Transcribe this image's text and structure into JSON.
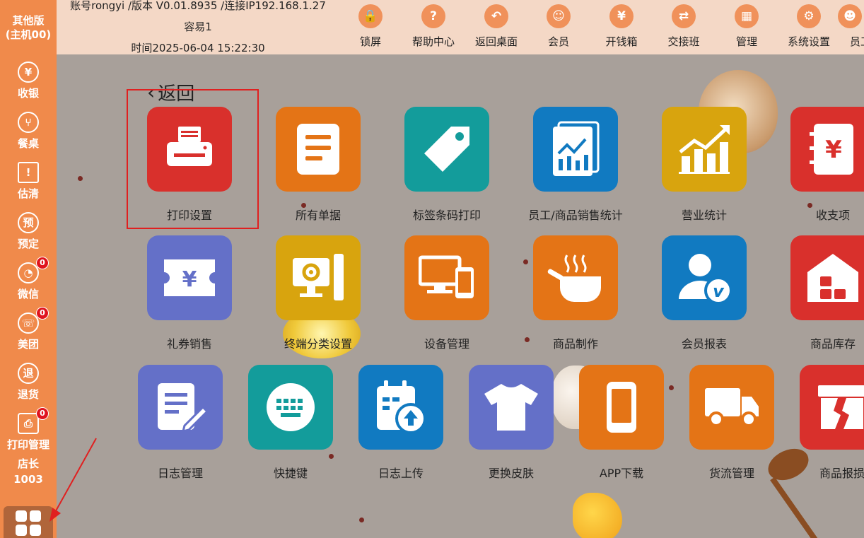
{
  "sidebar": {
    "brand_line1": "其他版",
    "brand_line2": "(主机00)",
    "items": [
      {
        "label": "收银",
        "glyph": "¥",
        "icon": "yen-icon",
        "badge": null
      },
      {
        "label": "餐桌",
        "glyph": "⑂",
        "icon": "fork-knife-icon",
        "badge": null
      },
      {
        "label": "估清",
        "glyph": "!",
        "icon": "warning-icon",
        "badge": null
      },
      {
        "label": "预定",
        "glyph": "预",
        "icon": "reserve-icon",
        "badge": null
      },
      {
        "label": "微信",
        "glyph": "◔",
        "icon": "wechat-icon",
        "badge": "0"
      },
      {
        "label": "美团",
        "glyph": "☏",
        "icon": "meituan-icon",
        "badge": "0"
      },
      {
        "label": "退货",
        "glyph": "退",
        "icon": "return-icon",
        "badge": null
      },
      {
        "label": "打印管理",
        "glyph": "⎙",
        "icon": "printer-icon",
        "badge": "0"
      }
    ],
    "user_role": "店长",
    "user_id": "1003"
  },
  "header": {
    "account_line": "账号rongyi /版本 V0.01.8935 /连接IP192.168.1.27",
    "store_name": "容易1",
    "time_line": "时间2025-06-04 15:22:30",
    "tools": [
      {
        "label": "锁屏",
        "glyph": "🔒",
        "icon": "lock-icon"
      },
      {
        "label": "帮助中心",
        "glyph": "?",
        "icon": "help-icon"
      },
      {
        "label": "返回桌面",
        "glyph": "↶",
        "icon": "back-arrow-icon"
      },
      {
        "label": "会员",
        "glyph": "☺",
        "icon": "member-icon"
      },
      {
        "label": "开钱箱",
        "glyph": "¥",
        "icon": "cashbox-icon"
      },
      {
        "label": "交接班",
        "glyph": "⇄",
        "icon": "shift-icon"
      },
      {
        "label": "管理",
        "glyph": "▦",
        "icon": "manage-icon"
      },
      {
        "label": "系统设置",
        "glyph": "⚙",
        "icon": "gear-icon"
      },
      {
        "label": "员工",
        "glyph": "☻",
        "icon": "staff-icon"
      }
    ]
  },
  "back_label": "返回",
  "tiles": [
    {
      "label": "打印设置",
      "color": "#d9302c",
      "icon": "printer-icon"
    },
    {
      "label": "所有单据",
      "color": "#e47416",
      "icon": "document-icon"
    },
    {
      "label": "标签条码打印",
      "color": "#139c9b",
      "icon": "tag-icon"
    },
    {
      "label": "员工/商品销售统计",
      "color": "#117ac1",
      "icon": "report-chart-icon"
    },
    {
      "label": "营业统计",
      "color": "#d8a40e",
      "icon": "trend-chart-icon"
    },
    {
      "label": "收支项",
      "color": "#d9302c",
      "icon": "ledger-yen-icon"
    },
    {
      "label": "礼券销售",
      "color": "#6470c8",
      "icon": "coupon-icon"
    },
    {
      "label": "终端分类设置",
      "color": "#d8a40e",
      "icon": "terminal-gear-icon"
    },
    {
      "label": "设备管理",
      "color": "#e47416",
      "icon": "devices-icon"
    },
    {
      "label": "商品制作",
      "color": "#e47416",
      "icon": "cooking-pot-icon"
    },
    {
      "label": "会员报表",
      "color": "#117ac1",
      "icon": "vip-member-icon"
    },
    {
      "label": "商品库存",
      "color": "#d9302c",
      "icon": "warehouse-icon"
    },
    {
      "label": "日志管理",
      "color": "#6470c8",
      "icon": "log-edit-icon"
    },
    {
      "label": "快捷键",
      "color": "#139c9b",
      "icon": "keyboard-icon"
    },
    {
      "label": "日志上传",
      "color": "#117ac1",
      "icon": "calendar-upload-icon"
    },
    {
      "label": "更换皮肤",
      "color": "#6470c8",
      "icon": "tshirt-icon"
    },
    {
      "label": "APP下载",
      "color": "#e47416",
      "icon": "phone-icon"
    },
    {
      "label": "货流管理",
      "color": "#e47416",
      "icon": "truck-icon"
    },
    {
      "label": "商品报损",
      "color": "#d9302c",
      "icon": "broken-box-icon"
    }
  ]
}
